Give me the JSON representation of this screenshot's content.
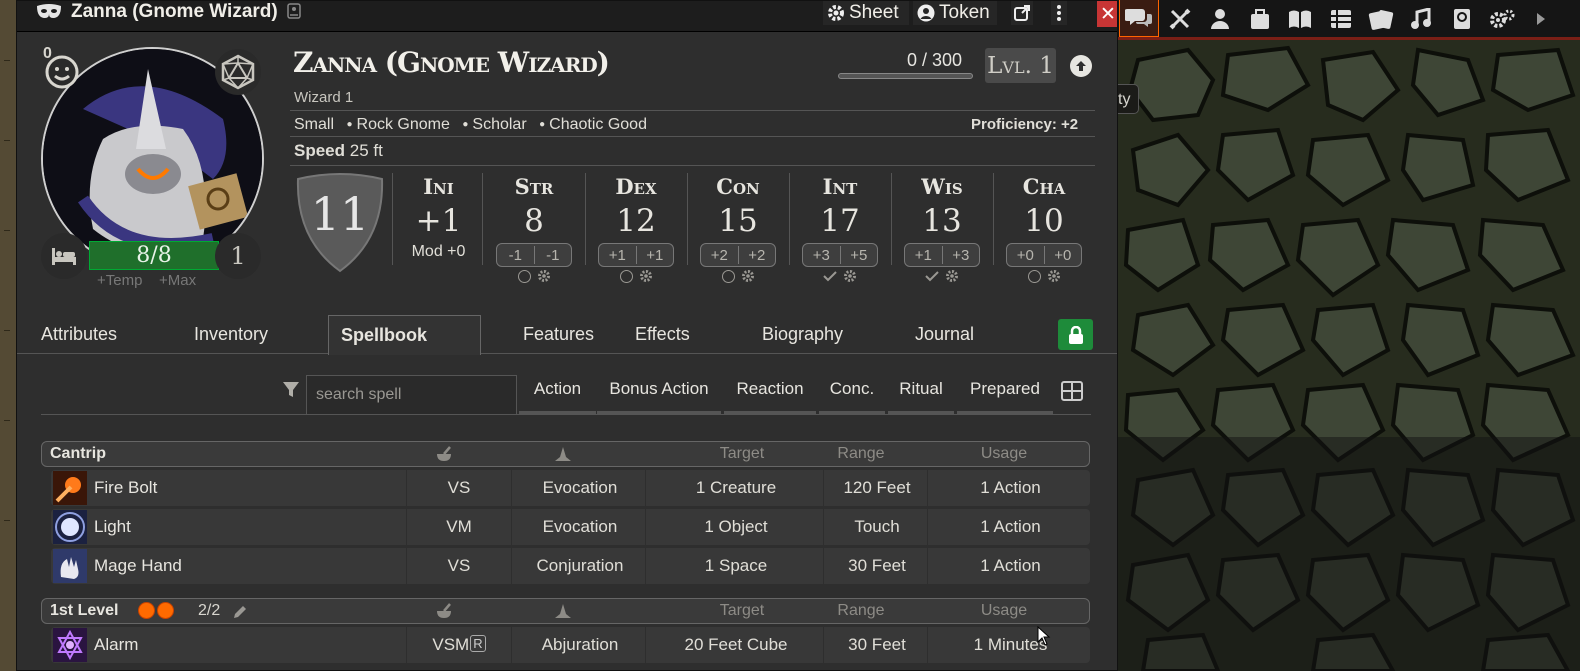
{
  "window": {
    "title": "Zanna (Gnome Wizard)",
    "sheet_label": "Sheet",
    "token_label": "Token",
    "close_label": "✕"
  },
  "character": {
    "name": "Zanna (Gnome Wizard)",
    "class_line": "Wizard 1",
    "details": [
      "Small",
      "Rock Gnome",
      "Scholar",
      "Chaotic Good"
    ],
    "proficiency": "Proficiency: +2",
    "speed_label": "Speed",
    "speed_value": "25 ft",
    "xp": "0 / 300",
    "xp_progress": 0,
    "level": "Lvl. 1",
    "hp": "8/8",
    "hit_dice": "1",
    "inspiration": "0",
    "temp_label": "+Temp",
    "max_label": "+Max",
    "ac": "11",
    "initiative": {
      "label": "Ini",
      "value": "+1",
      "mod": "Mod +0"
    }
  },
  "abilities": [
    {
      "abbr": "Str",
      "score": "8",
      "mod": "-1",
      "save": "-1",
      "proficient": false
    },
    {
      "abbr": "Dex",
      "score": "12",
      "mod": "+1",
      "save": "+1",
      "proficient": false
    },
    {
      "abbr": "Con",
      "score": "15",
      "mod": "+2",
      "save": "+2",
      "proficient": false
    },
    {
      "abbr": "Int",
      "score": "17",
      "mod": "+3",
      "save": "+5",
      "proficient": true
    },
    {
      "abbr": "Wis",
      "score": "13",
      "mod": "+1",
      "save": "+3",
      "proficient": true
    },
    {
      "abbr": "Cha",
      "score": "10",
      "mod": "+0",
      "save": "+0",
      "proficient": false
    }
  ],
  "tabs": [
    "Attributes",
    "Inventory",
    "Spellbook",
    "Features",
    "Effects",
    "Biography",
    "Journal"
  ],
  "active_tab": "Spellbook",
  "spell_filters": {
    "search_placeholder": "search spell",
    "buttons": [
      "Action",
      "Bonus Action",
      "Reaction",
      "Conc.",
      "Ritual",
      "Prepared"
    ]
  },
  "spell_columns": {
    "target": "Target",
    "range": "Range",
    "usage": "Usage"
  },
  "spell_sections": [
    {
      "label": "Cantrip",
      "slots": "",
      "spells": [
        {
          "name": "Fire Bolt",
          "components": "VS",
          "school": "Evocation",
          "target": "1 Creature",
          "range": "120 Feet",
          "usage": "1 Action"
        },
        {
          "name": "Light",
          "components": "VM",
          "school": "Evocation",
          "target": "1 Object",
          "range": "Touch",
          "usage": "1 Action"
        },
        {
          "name": "Mage Hand",
          "components": "VS",
          "school": "Conjuration",
          "target": "1 Space",
          "range": "30 Feet",
          "usage": "1 Action"
        }
      ]
    },
    {
      "label": "1st Level",
      "slots": "2/2",
      "spells": [
        {
          "name": "Alarm",
          "components": "VSM",
          "ritual_mark": "R",
          "school": "Abjuration",
          "target": "20 Feet Cube",
          "range": "30 Feet",
          "usage": "1 Minutes"
        }
      ]
    }
  ],
  "map": {
    "label_fragment": "ty"
  },
  "colors": {
    "accent_orange": "#ff6400",
    "hp_green": "#1f6f2b",
    "close_red": "#c73535",
    "lock_green": "#1e8b3a"
  }
}
